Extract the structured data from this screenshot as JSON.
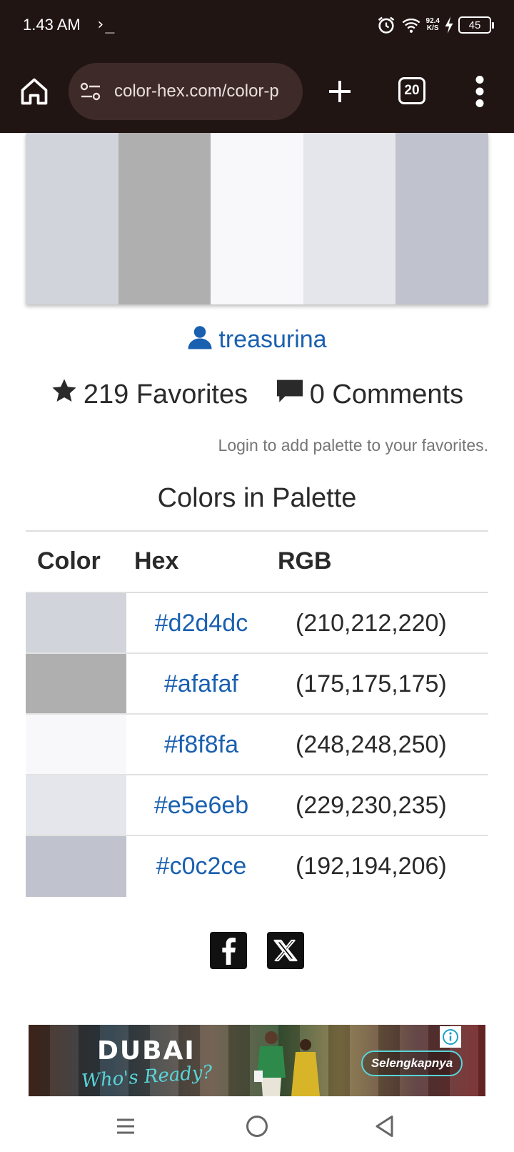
{
  "status_bar": {
    "time": "1.43 AM",
    "terminal_glyph": "›_",
    "net_speed_value": "92.4",
    "net_speed_unit": "K/S",
    "battery": "45"
  },
  "browser": {
    "url": "color-hex.com/color-p",
    "tab_count": "20"
  },
  "palette": {
    "swatches": [
      "#d2d4dc",
      "#afafaf",
      "#f8f8fa",
      "#e5e6eb",
      "#c0c2ce"
    ]
  },
  "author": {
    "name": "treasurina"
  },
  "stats": {
    "favorites": "219 Favorites",
    "comments": "0 Comments"
  },
  "login_note": "Login to add palette to your favorites.",
  "section_title": "Colors in Palette",
  "table": {
    "headers": {
      "color": "Color",
      "hex": "Hex",
      "rgb": "RGB"
    },
    "rows": [
      {
        "hex": "#d2d4dc",
        "rgb": "(210,212,220)"
      },
      {
        "hex": "#afafaf",
        "rgb": "(175,175,175)"
      },
      {
        "hex": "#f8f8fa",
        "rgb": "(248,248,250)"
      },
      {
        "hex": "#e5e6eb",
        "rgb": "(229,230,235)"
      },
      {
        "hex": "#c0c2ce",
        "rgb": "(192,194,206)"
      }
    ]
  },
  "social": {
    "icons": [
      "facebook-icon",
      "x-icon"
    ]
  },
  "ad": {
    "brand": "DUBAI",
    "tagline": "Who's Ready?",
    "cta": "Selengkapnya"
  },
  "colors": {
    "chrome_bg": "#211514",
    "url_bg": "#3e2b29",
    "link": "#1a60b0"
  }
}
